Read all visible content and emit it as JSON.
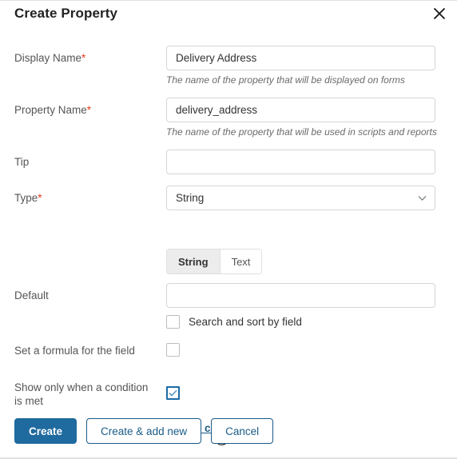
{
  "header": {
    "title": "Create Property",
    "close_icon": "close-icon"
  },
  "colors": {
    "primary": "#1f6a9e",
    "link": "#1b5b87",
    "required_asterisk": "#e8391d",
    "checkbox_checked_border": "#1b6aa5",
    "input_border": "#d6d6d6"
  },
  "form": {
    "display_name": {
      "label": "Display Name",
      "required_marker": "*",
      "value": "Delivery Address",
      "placeholder": "",
      "hint": "The name of the property that will be displayed on forms"
    },
    "property_name": {
      "label": "Property Name",
      "required_marker": "*",
      "value": "delivery_address",
      "placeholder": "",
      "hint": "The name of the property that will be used in scripts and reports"
    },
    "tip": {
      "label": "Tip",
      "value": "",
      "placeholder": ""
    },
    "type": {
      "label": "Type",
      "required_marker": "*",
      "selected": "String",
      "options": [
        "String"
      ],
      "chevron_icon": "chevron-down-icon"
    },
    "subtype": {
      "options": [
        "String",
        "Text"
      ],
      "selected": "String"
    },
    "default": {
      "label": "Default",
      "value": "",
      "placeholder": ""
    },
    "search_sort": {
      "label": "Search and sort by field",
      "checked": false
    },
    "formula": {
      "label": "Set a formula for the field",
      "checked": false
    },
    "condition": {
      "label": "Show only when a condition is met",
      "checked": true,
      "link_label": "Set up conditions"
    }
  },
  "footer": {
    "create_label": "Create",
    "create_add_new_label": "Create & add new",
    "cancel_label": "Cancel"
  }
}
